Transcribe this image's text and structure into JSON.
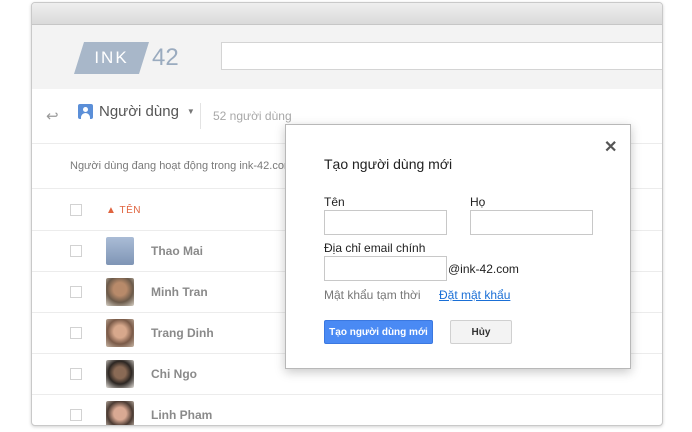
{
  "app": {
    "logo_ink": "INK",
    "logo_num": "42"
  },
  "toolbar": {
    "back_icon": "arrow-left-icon",
    "people_label": "Người dùng",
    "user_count": "52 người dùng"
  },
  "subheader": {
    "text": "Người dùng đang hoạt động trong ink-42.com"
  },
  "table": {
    "name_column": "TÊN",
    "sort_icon": "sort-ascending-icon",
    "rows": [
      {
        "name": "Thao Mai"
      },
      {
        "name": "Minh Tran"
      },
      {
        "name": "Trang Dinh"
      },
      {
        "name": "Chi Ngo"
      },
      {
        "name": "Linh Pham"
      }
    ]
  },
  "dialog": {
    "title": "Tạo người dùng mới",
    "close_icon": "close-icon",
    "first_name_label": "Tên",
    "last_name_label": "Họ",
    "email_label": "Địa chỉ email chính",
    "first_name_value": "",
    "last_name_value": "",
    "email_value": "",
    "domain": "@ink-42.com",
    "temp_password_label": "Mật khẩu tạm thời",
    "set_password_link": "Đặt mật khẩu",
    "create_button": "Tạo người dùng mới",
    "cancel_button": "Hủy"
  },
  "colors": {
    "accent": "#4a8af4",
    "sort_accent": "#e0643f",
    "link": "#1a6fd6"
  }
}
